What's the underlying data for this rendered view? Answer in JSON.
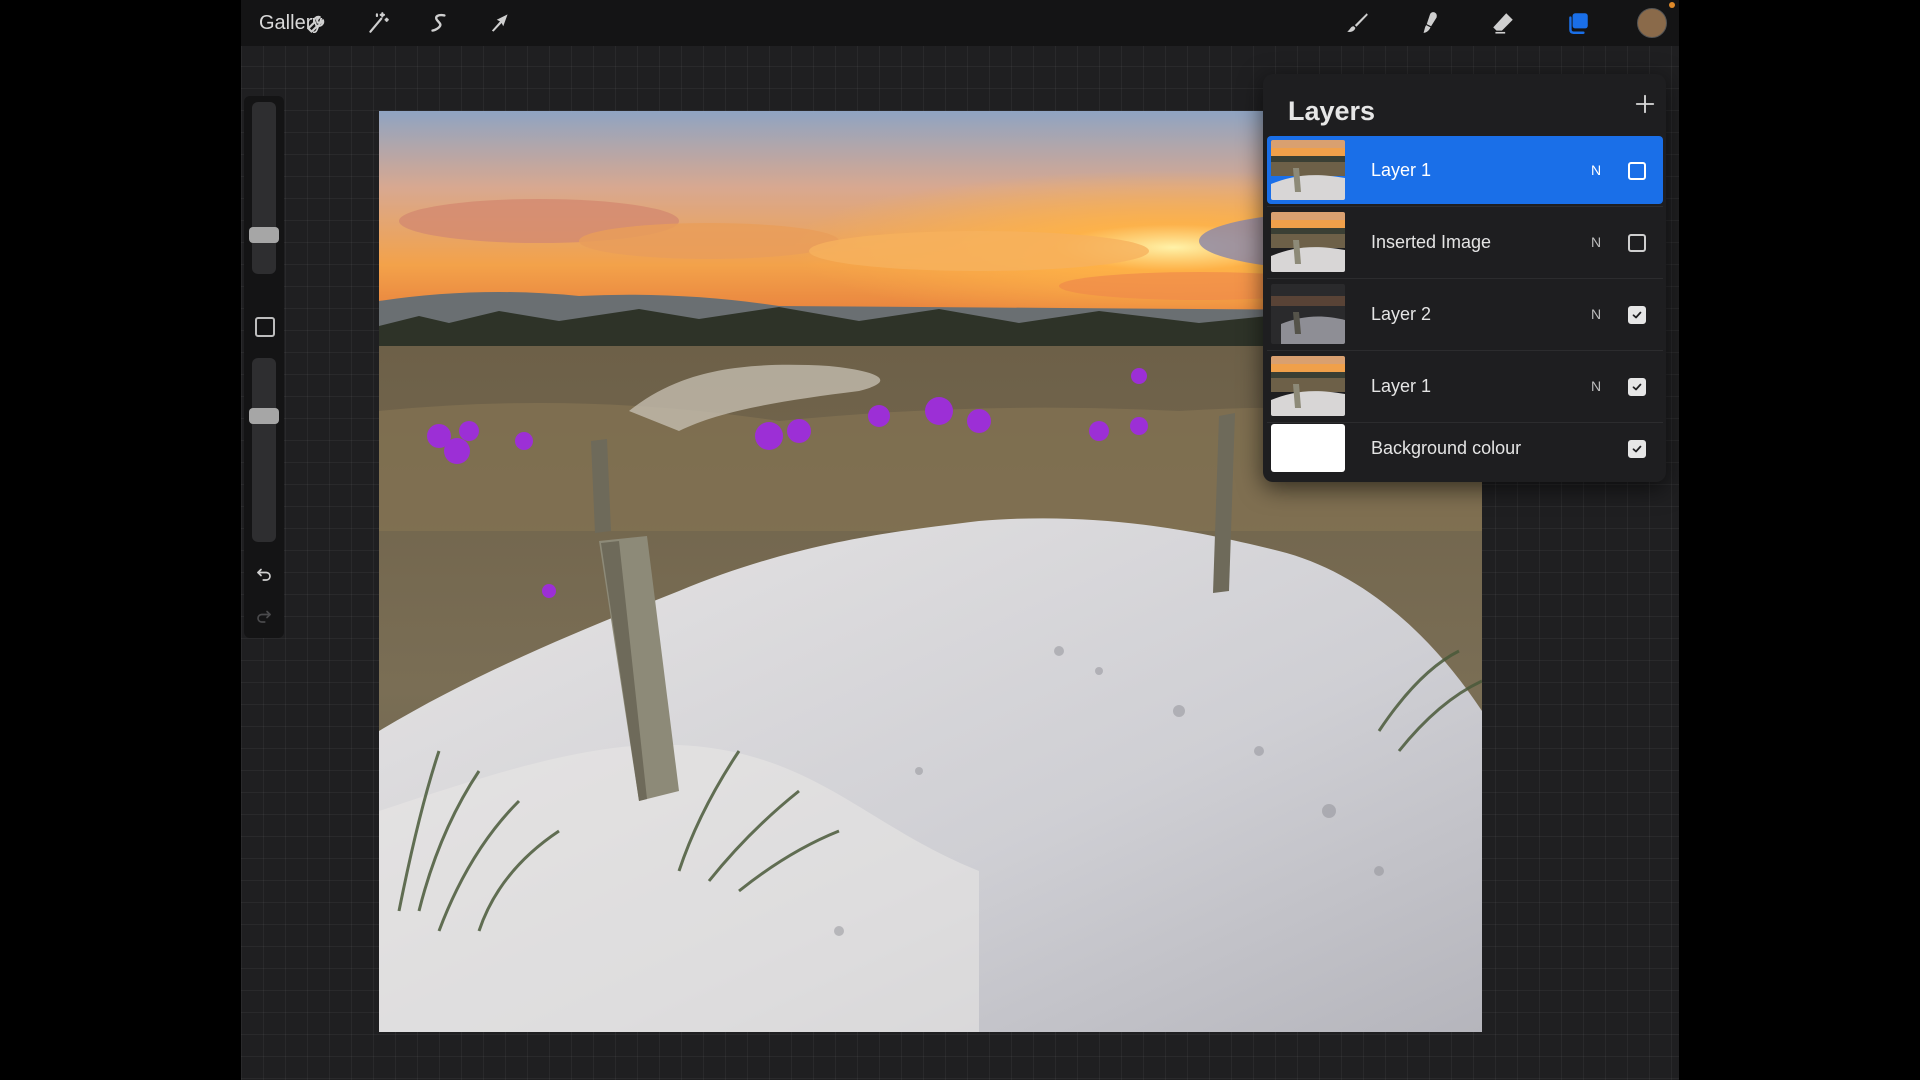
{
  "toolbar": {
    "gallery_label": "Gallery",
    "left_tools": [
      {
        "name": "actions-wrench-icon"
      },
      {
        "name": "adjustments-wand-icon"
      },
      {
        "name": "selection-s-icon"
      },
      {
        "name": "transform-arrow-icon"
      }
    ],
    "right_tools": [
      {
        "name": "brush-icon"
      },
      {
        "name": "smudge-icon"
      },
      {
        "name": "eraser-icon"
      },
      {
        "name": "layers-icon",
        "active": true
      }
    ],
    "current_color": "#8a6a4a",
    "accent_color": "#1a6fe8",
    "notification_dot_color": "#e08a2a"
  },
  "sidebar": {
    "brush_size": 0.2,
    "brush_opacity": 0.7,
    "undo_icon": "undo-icon",
    "redo_icon": "redo-icon"
  },
  "layers": {
    "title": "Layers",
    "add_icon": "plus-icon",
    "items": [
      {
        "name": "Layer 1",
        "mode": "N",
        "visible": false,
        "active": true,
        "thumb": "photo"
      },
      {
        "name": "Inserted Image",
        "mode": "N",
        "visible": false,
        "active": false,
        "thumb": "photo"
      },
      {
        "name": "Layer 2",
        "mode": "N",
        "visible": true,
        "active": false,
        "thumb": "dark"
      },
      {
        "name": "Layer 1",
        "mode": "N",
        "visible": true,
        "active": false,
        "thumb": "photo"
      },
      {
        "name": "Background colour",
        "mode": "",
        "visible": true,
        "active": false,
        "thumb": "white"
      }
    ]
  }
}
